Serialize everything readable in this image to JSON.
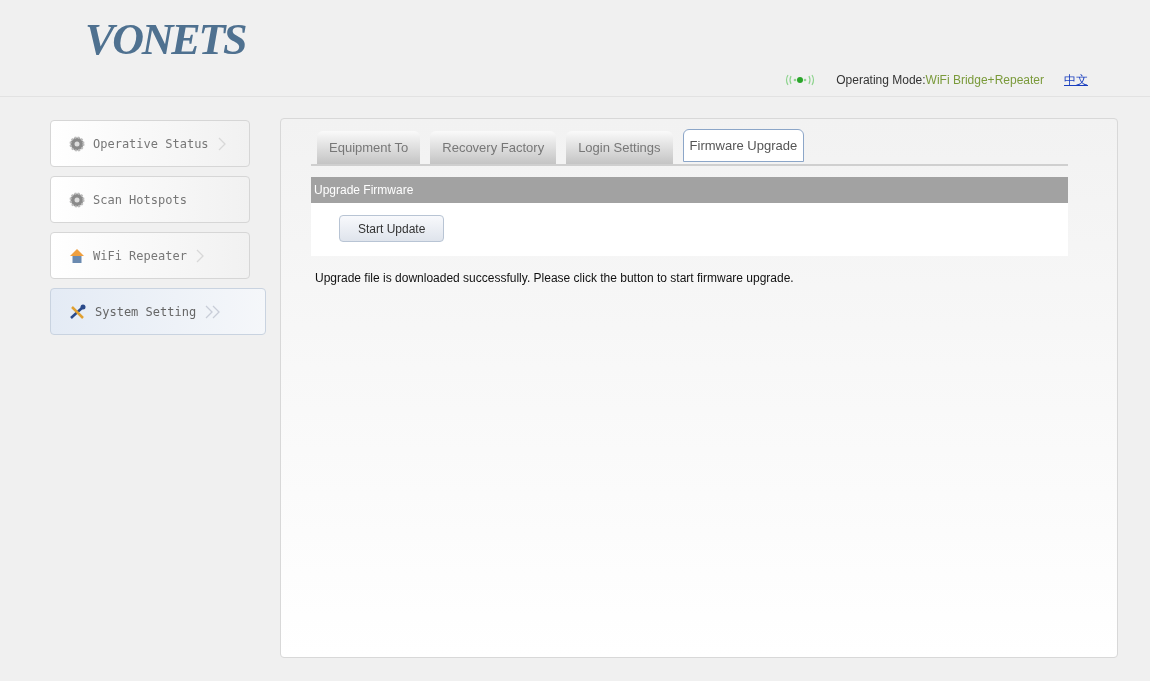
{
  "header": {
    "logo": "VONETS",
    "mode_label": "Operating Mode:",
    "mode_value": "WiFi Bridge+Repeater",
    "language_link": "中文"
  },
  "sidebar": {
    "items": [
      {
        "label": "Operative Status",
        "kind": "gear",
        "arrow": true,
        "selected": false
      },
      {
        "label": "Scan Hotspots",
        "kind": "gear",
        "arrow": false,
        "selected": false
      },
      {
        "label": "WiFi Repeater",
        "kind": "house",
        "arrow": true,
        "selected": false
      },
      {
        "label": "System Setting",
        "kind": "tools",
        "arrow": true,
        "selected": true
      }
    ]
  },
  "tabs": [
    {
      "label": "Equipment To",
      "selected": false
    },
    {
      "label": "Recovery Factory",
      "selected": false
    },
    {
      "label": "Login Settings",
      "selected": false
    },
    {
      "label": "Firmware Upgrade",
      "selected": true
    }
  ],
  "section": {
    "title": "Upgrade Firmware",
    "button": "Start Update",
    "message": "Upgrade file is downloaded successfully. Please click the button to start firmware upgrade."
  }
}
